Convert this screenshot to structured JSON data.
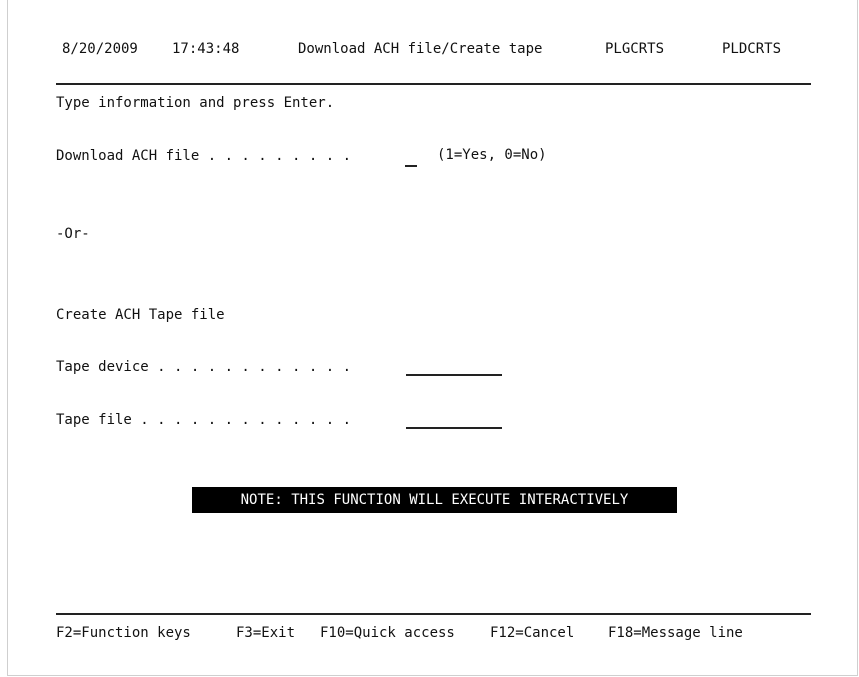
{
  "header": {
    "date": "8/20/2009",
    "time": "17:43:48",
    "title": "Download ACH file/Create tape",
    "program1": "PLGCRTS",
    "program2": "PLDCRTS"
  },
  "instruction": "Type information and press Enter.",
  "download": {
    "label": "Download ACH file . . . . . . . . .",
    "value": "",
    "hint": "(1=Yes, 0=No)"
  },
  "or_text": "-Or-",
  "create_label": "Create ACH Tape file",
  "tape_device": {
    "label": "Tape device . . . . . . . . . . . .",
    "value": ""
  },
  "tape_file": {
    "label": "Tape file . . . . . . . . . . . . .",
    "value": ""
  },
  "note": "NOTE: THIS FUNCTION WILL EXECUTE INTERACTIVELY",
  "function_keys": [
    "F2=Function keys",
    "F3=Exit",
    "F10=Quick access",
    "F12=Cancel",
    "F18=Message line"
  ]
}
